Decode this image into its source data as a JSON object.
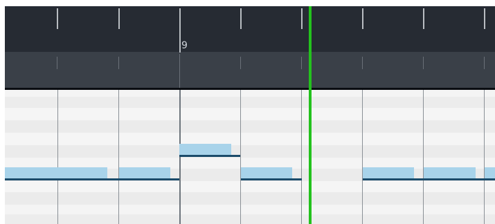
{
  "timeline": {
    "bar_label": "9"
  },
  "colors": {
    "ruler_bg": "#262b33",
    "ruler_lower_bg": "#3a4048",
    "grid_light": "#f4f4f4",
    "grid_dark": "#e9e9e9",
    "note_fill": "#a8d3ea",
    "note_line": "#1b4b6a",
    "playhead": "#23c21d"
  }
}
